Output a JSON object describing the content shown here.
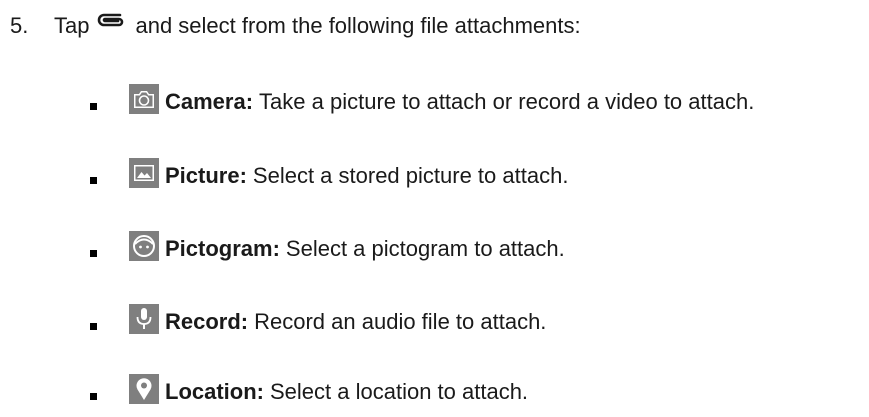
{
  "step": {
    "number": "5.",
    "text_before": "Tap",
    "text_after": "and select from the following file attachments:",
    "icon": "paperclip-icon"
  },
  "items": [
    {
      "icon": "camera-icon",
      "term": "Camera:",
      "description": "Take a picture to attach or record a video to attach."
    },
    {
      "icon": "picture-icon",
      "term": "Picture:",
      "description": "Select a stored picture to attach."
    },
    {
      "icon": "pictogram-icon",
      "term": "Pictogram:",
      "description": "Select a pictogram to attach."
    },
    {
      "icon": "microphone-icon",
      "term": "Record:",
      "description": "Record an audio file to attach."
    },
    {
      "icon": "location-pin-icon",
      "term": "Location:",
      "description": "Select a location to attach."
    }
  ],
  "colors": {
    "icon_tile": "#7f7f7f",
    "text": "#1a1a1a"
  }
}
